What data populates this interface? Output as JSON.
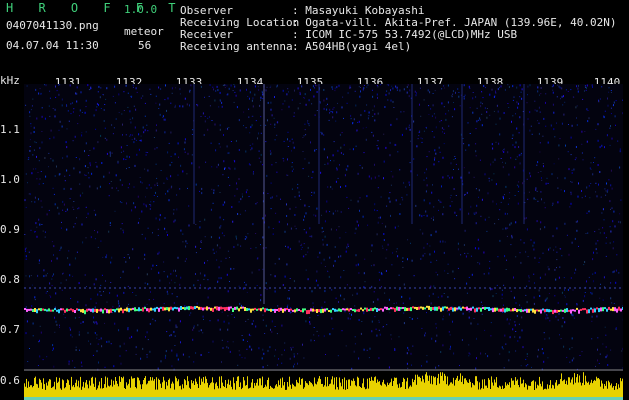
{
  "header": {
    "app_name": "H R O F F T",
    "version": "1.0.0",
    "filename": "0407041130.png",
    "mode_label": "meteor",
    "datetime": "04.07.04 11:30",
    "count": "56",
    "info": [
      {
        "label": "Observer",
        "value": ": Masayuki Kobayashi"
      },
      {
        "label": "Receiving Location",
        "value": ": Ogata-vill. Akita-Pref. JAPAN (139.96E, 40.02N)"
      },
      {
        "label": "Receiver",
        "value": ": ICOM IC-575 53.7492(@LCD)MHz USB"
      },
      {
        "label": "Receiving antenna",
        "value": ": A504HB(yagi 4el)"
      }
    ]
  },
  "axis": {
    "unit": "kHz",
    "y_labels": [
      "1.1",
      "1.0",
      "0.9",
      "0.8",
      "0.7",
      "0.6"
    ],
    "x_ticks": [
      "1131",
      "1132",
      "1133",
      "1134",
      "1135",
      "1136",
      "1137",
      "1138",
      "1139",
      "1140"
    ]
  },
  "colors": {
    "background": "#000000",
    "noise": "#1a2a9a",
    "signal": "#ff3060",
    "spectrum": "#e8d200"
  }
}
